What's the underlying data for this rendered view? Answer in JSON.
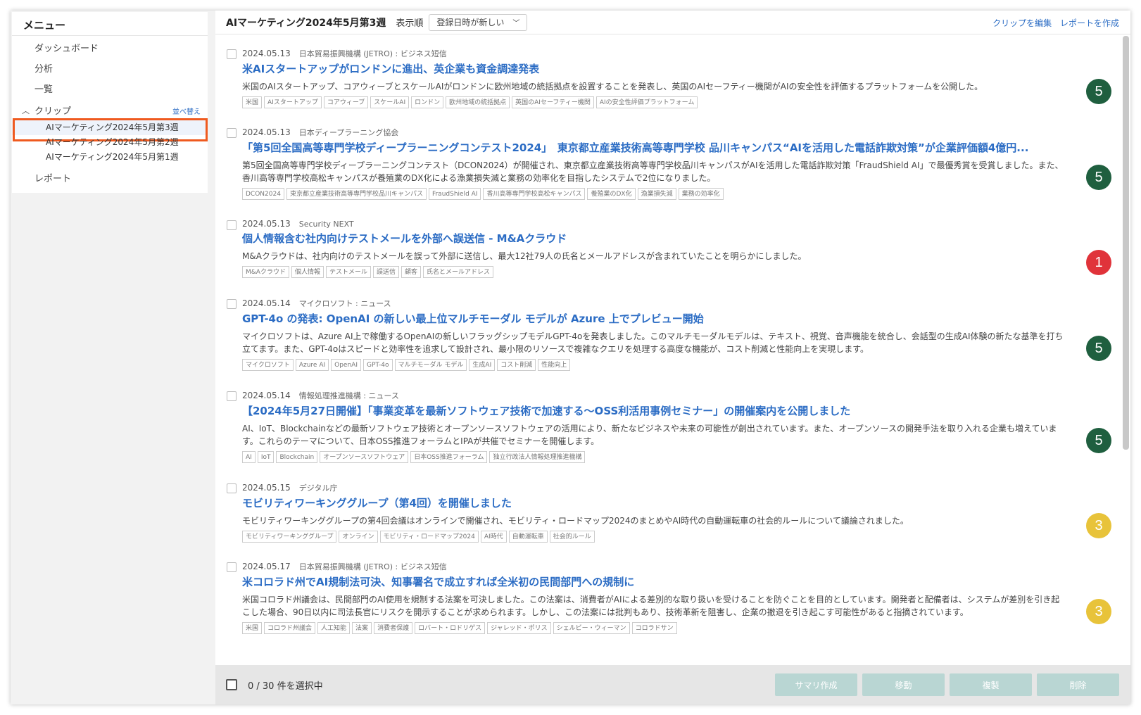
{
  "sidebar": {
    "title": "メニュー",
    "nav": [
      "ダッシュボード",
      "分析",
      "一覧"
    ],
    "clip_label": "クリップ",
    "sort_label": "並べ替え",
    "clips": [
      "AIマーケティング2024年5月第3週",
      "AIマーケティング2024年5月第2週",
      "AIマーケティング2024年5月第1週"
    ],
    "report": "レポート"
  },
  "header": {
    "title": "AIマーケティング2024年5月第3週",
    "order_label": "表示順",
    "order_value": "登録日時が新しい",
    "edit_clip": "クリップを編集",
    "create_report": "レポートを作成"
  },
  "colors": {
    "green": "#1f5f3f",
    "red": "#e0333a",
    "yellow": "#e8c33a",
    "link": "#2b6cc4"
  },
  "articles": [
    {
      "date": "2024.05.13",
      "source": "日本貿易振興機構 (JETRO) : ビジネス短信",
      "title": "米AIスタートアップがロンドンに進出、英企業も資金調達発表",
      "summary": "米国のAIスタートアップ、コアウィーブとスケールAIがロンドンに欧州地域の統括拠点を設置することを発表し、英国のAIセーフティー機関がAIの安全性を評価するプラットフォームを公開した。",
      "tags": [
        "米国",
        "AIスタートアップ",
        "コアウィーブ",
        "スケールAI",
        "ロンドン",
        "欧州地域の統括拠点",
        "英国のAIセーフティー機関",
        "AIの安全性評価プラットフォーム"
      ],
      "score": "5",
      "score_color": "green"
    },
    {
      "date": "2024.05.13",
      "source": "日本ディープラーニング協会",
      "title": "「第5回全国高等専門学校ディープラーニングコンテスト2024」　東京都立産業技術高等専門学校 品川キャンパス“AIを活用した電話詐欺対策”が企業評価額4億円...",
      "summary": "第5回全国高等専門学校ディープラーニングコンテスト（DCON2024）が開催され、東京都立産業技術高等専門学校品川キャンパスがAIを活用した電話詐欺対策「FraudShield AI」で最優秀賞を受賞しました。また、香川高等専門学校高松キャンパスが養殖業のDX化による漁業損失減と業務の効率化を目指したシステムで2位になりました。",
      "tags": [
        "DCON2024",
        "東京都立産業技術高等専門学校品川キャンパス",
        "FraudShield AI",
        "香川高等専門学校高松キャンパス",
        "養殖業のDX化",
        "漁業損失減",
        "業務の効率化"
      ],
      "score": "5",
      "score_color": "green"
    },
    {
      "date": "2024.05.13",
      "source": "Security NEXT",
      "title": "個人情報含む社内向けテストメールを外部へ誤送信 - M&Aクラウド",
      "summary": "M&Aクラウドは、社内向けのテストメールを誤って外部に送信し、最大12社79人の氏名とメールアドレスが含まれていたことを明らかにしました。",
      "tags": [
        "M&Aクラウド",
        "個人情報",
        "テストメール",
        "誤送信",
        "顧客",
        "氏名とメールアドレス"
      ],
      "score": "1",
      "score_color": "red"
    },
    {
      "date": "2024.05.14",
      "source": "マイクロソフト : ニュース",
      "title": "GPT-4o の発表: OpenAI の新しい最上位マルチモーダル モデルが Azure 上でプレビュー開始",
      "summary": "マイクロソフトは、Azure AI上で稼働するOpenAIの新しいフラッグシップモデルGPT-4oを発表しました。このマルチモーダルモデルは、テキスト、視覚、音声機能を統合し、会話型の生成AI体験の新たな基準を打ち立てます。また、GPT-4oはスピードと効率性を追求して設計され、最小限のリソースで複雑なクエリを処理する高度な機能が、コスト削減と性能向上を実現します。",
      "tags": [
        "マイクロソフト",
        "Azure AI",
        "OpenAI",
        "GPT-4o",
        "マルチモーダル モデル",
        "生成AI",
        "コスト削減",
        "性能向上"
      ],
      "score": "5",
      "score_color": "green"
    },
    {
      "date": "2024.05.14",
      "source": "情報処理推進機構 : ニュース",
      "title": "【2024年5月27日開催】「事業変革を最新ソフトウェア技術で加速する〜OSS利活用事例セミナー」の開催案内を公開しました",
      "summary": "AI、IoT、Blockchainなどの最新ソフトウェア技術とオープンソースソフトウェアの活用により、新たなビジネスや未来の可能性が創出されています。また、オープンソースの開発手法を取り入れる企業も増えています。これらのテーマについて、日本OSS推進フォーラムとIPAが共催でセミナーを開催します。",
      "tags": [
        "AI",
        "IoT",
        "Blockchain",
        "オープンソースソフトウェア",
        "日本OSS推進フォーラム",
        "独立行政法人情報処理推進機構"
      ],
      "score": "5",
      "score_color": "green"
    },
    {
      "date": "2024.05.15",
      "source": "デジタル庁",
      "title": "モビリティワーキンググループ（第4回）を開催しました",
      "summary": "モビリティワーキンググループの第4回会議はオンラインで開催され、モビリティ・ロードマップ2024のまとめやAI時代の自動運転車の社会的ルールについて議論されました。",
      "tags": [
        "モビリティワーキンググループ",
        "オンライン",
        "モビリティ・ロードマップ2024",
        "AI時代",
        "自動運転車",
        "社会的ルール"
      ],
      "score": "3",
      "score_color": "yellow"
    },
    {
      "date": "2024.05.17",
      "source": "日本貿易振興機構 (JETRO) : ビジネス短信",
      "title": "米コロラド州でAI規制法可決、知事署名で成立すれば全米初の民間部門への規制に",
      "summary": "米国コロラド州議会は、民間部門のAI使用を規制する法案を可決しました。この法案は、消費者がAIによる差別的な取り扱いを受けることを防ぐことを目的としています。開発者と配備者は、システムが差別を引き起こした場合、90日以内に司法長官にリスクを開示することが求められます。しかし、この法案には批判もあり、技術革新を阻害し、企業の撤退を引き起こす可能性があると指摘されています。",
      "tags": [
        "米国",
        "コロラド州議会",
        "人工知能",
        "法案",
        "消費者保護",
        "ロバート・ロドリゲス",
        "ジャレッド・ポリス",
        "シェルビー・ウィーマン",
        "コロラドサン"
      ],
      "score": "3",
      "score_color": "yellow"
    }
  ],
  "footer": {
    "count": "0 / 30 件を選択中",
    "buttons": [
      "サマリ作成",
      "移動",
      "複製",
      "削除"
    ]
  }
}
